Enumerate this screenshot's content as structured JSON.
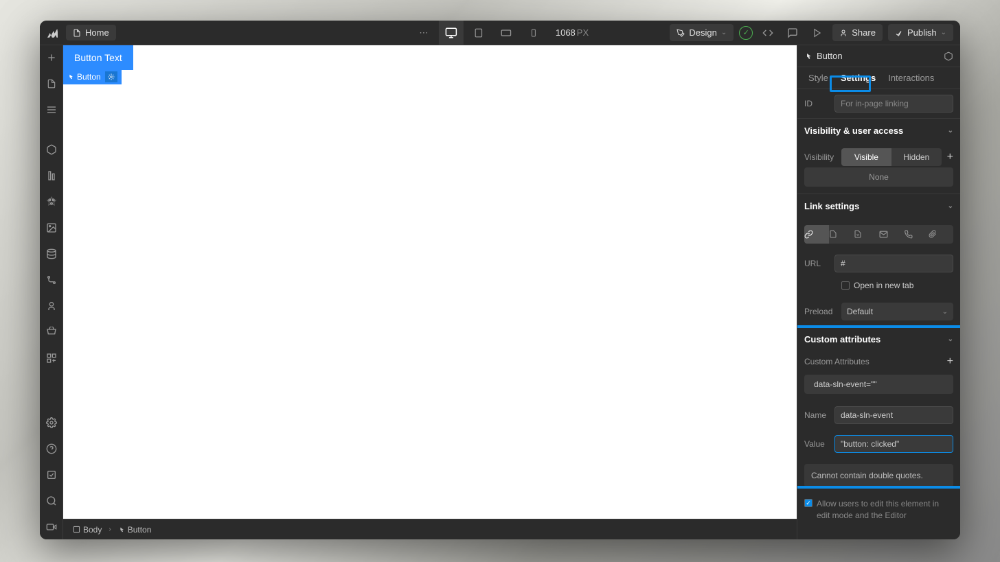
{
  "topbar": {
    "page": "Home",
    "width_value": "1068",
    "width_unit": "PX",
    "mode": "Design",
    "share": "Share",
    "publish": "Publish"
  },
  "canvas": {
    "button_text": "Button Text",
    "sel_label": "Button"
  },
  "breadcrumb": {
    "body": "Body",
    "button": "Button"
  },
  "panel": {
    "element": "Button",
    "tabs": {
      "style": "Style",
      "settings": "Settings",
      "interactions": "Interactions"
    },
    "id_label": "ID",
    "id_placeholder": "For in-page linking",
    "visibility_header": "Visibility & user access",
    "visibility_label": "Visibility",
    "visible": "Visible",
    "hidden": "Hidden",
    "none": "None",
    "link_header": "Link settings",
    "url_label": "URL",
    "url_value": "#",
    "open_new_tab": "Open in new tab",
    "preload_label": "Preload",
    "preload_value": "Default",
    "ca_header": "Custom attributes",
    "ca_sub": "Custom Attributes",
    "ca_chip": "data-sln-event=\"\"",
    "name_label": "Name",
    "name_value": "data-sln-event",
    "value_label": "Value",
    "value_value": "\"button: clicked\"",
    "error": "Cannot contain double quotes.",
    "edit_allow": "Allow users to edit this element in edit mode and the Editor"
  }
}
